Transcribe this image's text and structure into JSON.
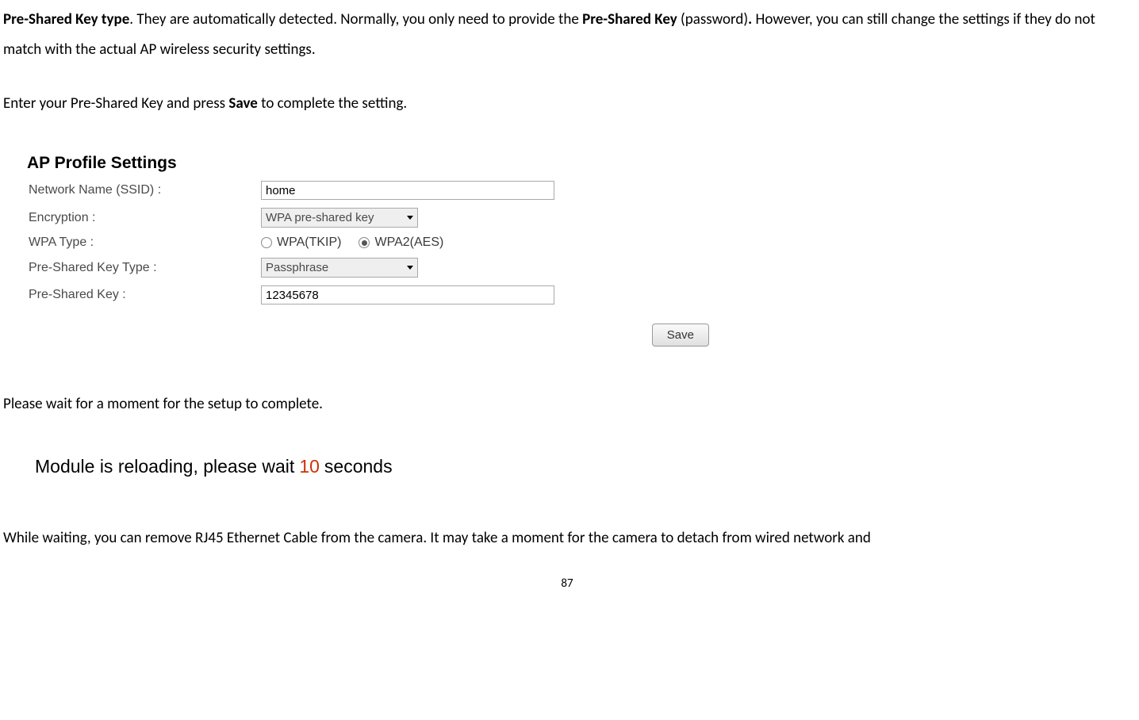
{
  "intro": {
    "bold1": "Pre-Shared Key type",
    "text1": ". They are automatically detected. Normally, you only need to provide the ",
    "bold2": "Pre-Shared Key ",
    "text2": "(password)",
    "bold3": ". ",
    "text3": "However, you can still change the settings if they do not match with the actual AP wireless security settings."
  },
  "instruction": {
    "text1": "Enter your Pre-Shared Key and press ",
    "bold1": "Save ",
    "text2": "to complete the setting."
  },
  "panel": {
    "title": "AP Profile Settings",
    "ssid_label": "Network Name (SSID) :",
    "ssid_value": "home",
    "encryption_label": "Encryption :",
    "encryption_value": "WPA pre-shared key",
    "wpa_type_label": "WPA Type :",
    "wpa_option1": "WPA(TKIP)",
    "wpa_option2": "WPA2(AES)",
    "psk_type_label": "Pre-Shared Key Type :",
    "psk_type_value": "Passphrase",
    "psk_label": "Pre-Shared Key :",
    "psk_value": "12345678",
    "save_label": "Save"
  },
  "wait_text": "Please wait for a moment for the setup to complete.",
  "reload": {
    "prefix": "Module is reloading, please wait",
    "count": "10",
    "suffix": "seconds"
  },
  "final_text": "While waiting, you can remove RJ45 Ethernet Cable from the camera. It may take a moment for the camera to detach from wired network and",
  "page_number": "87"
}
